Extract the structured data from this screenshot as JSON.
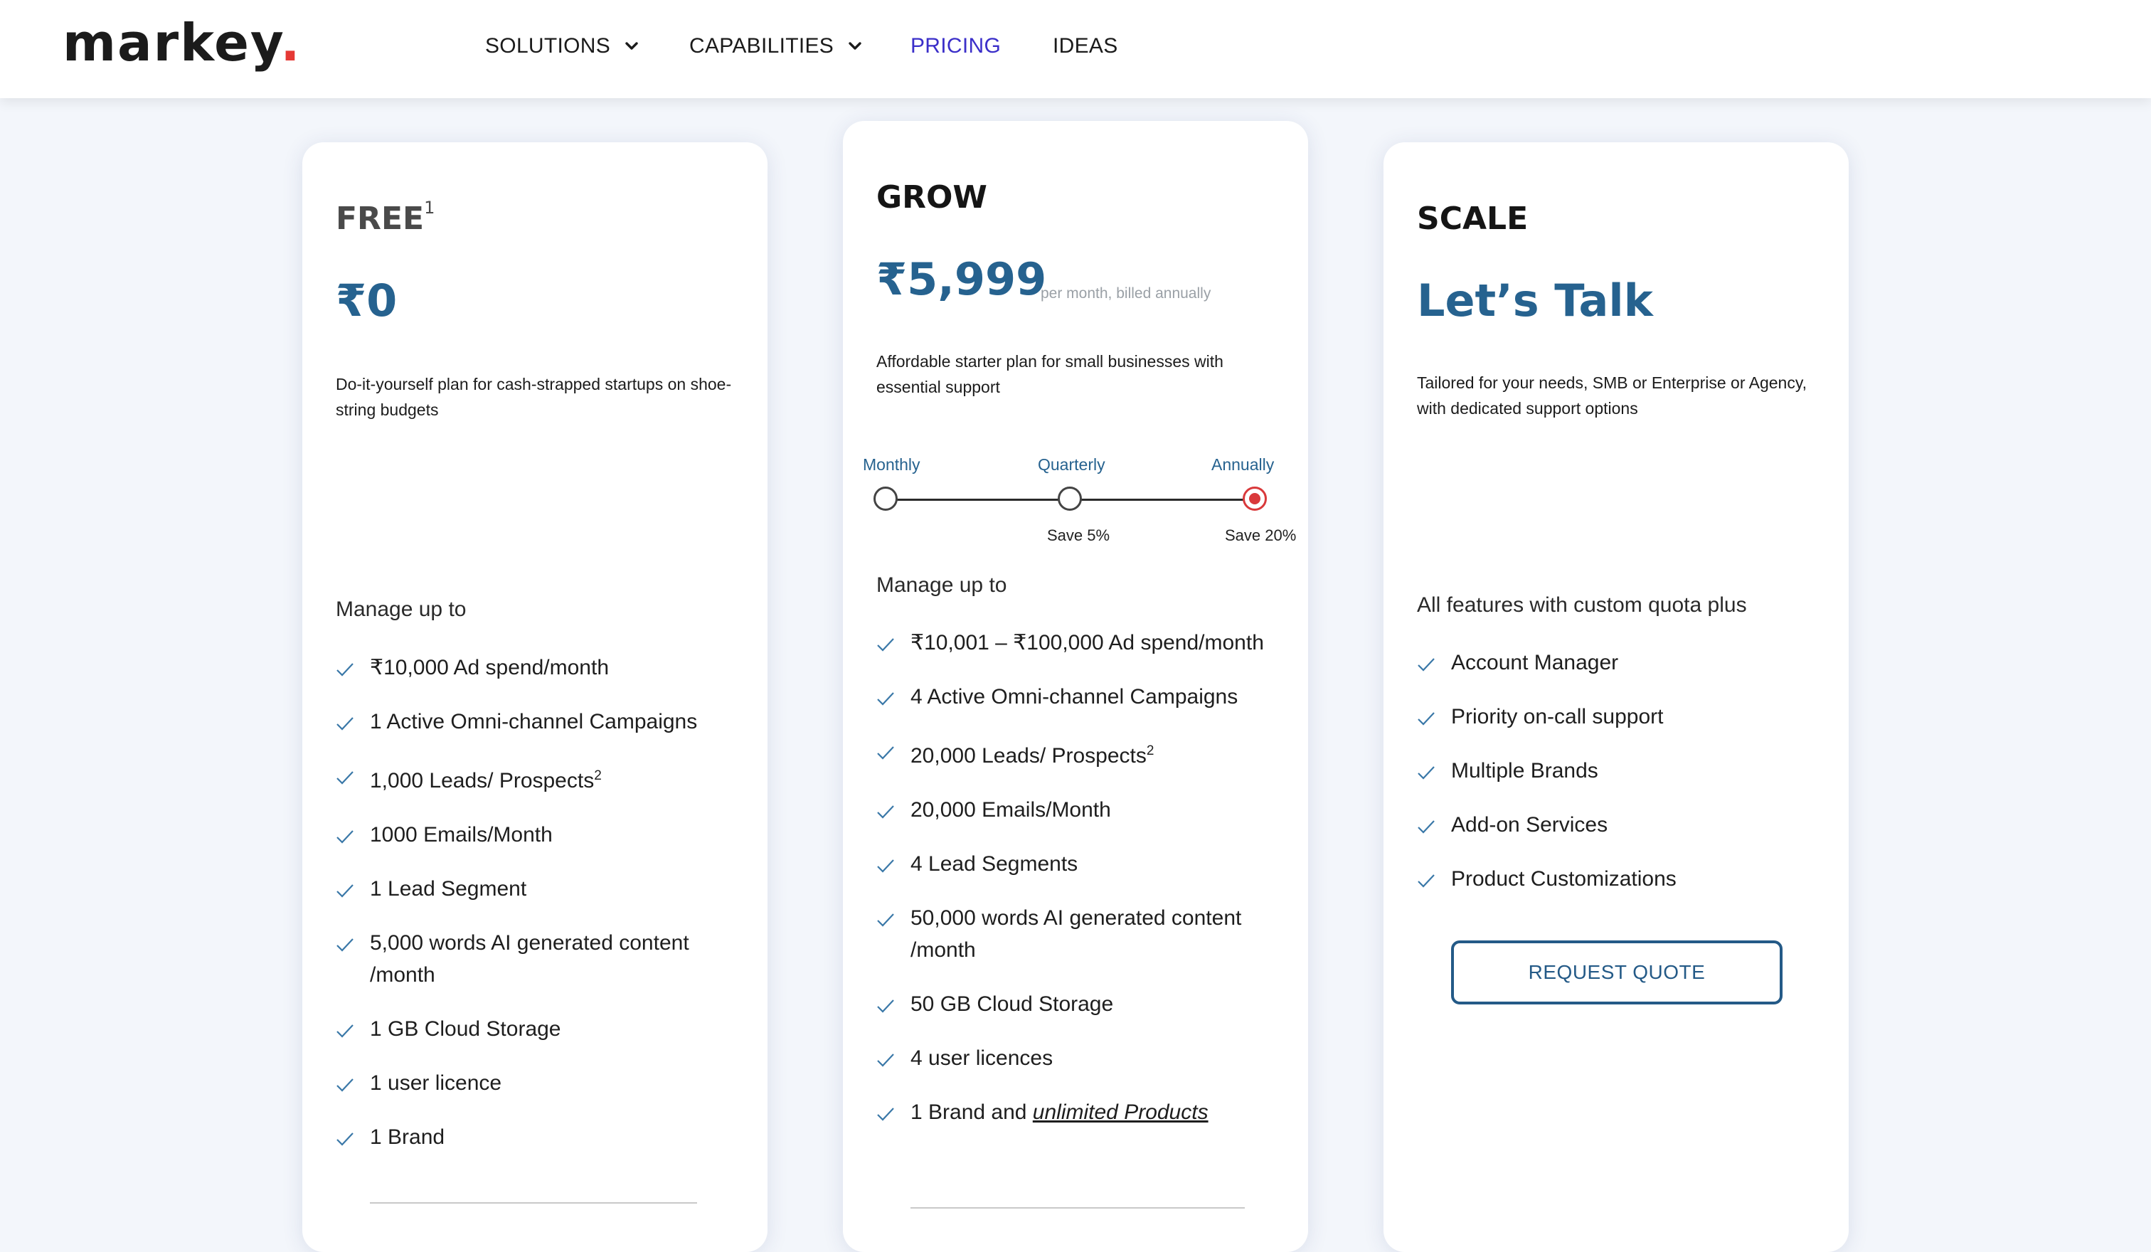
{
  "header": {
    "logo_text": "markey",
    "logo_dot": ".",
    "nav": [
      {
        "label": "SOLUTIONS",
        "has_dropdown": true,
        "active": false
      },
      {
        "label": "CAPABILITIES",
        "has_dropdown": true,
        "active": false
      },
      {
        "label": "PRICING",
        "has_dropdown": false,
        "active": true
      },
      {
        "label": "IDEAS",
        "has_dropdown": false,
        "active": false
      }
    ]
  },
  "colors": {
    "accent_blue": "#26628f",
    "nav_active": "#3b2fc9",
    "logo_dot": "#e53935",
    "selected_red": "#d9393b"
  },
  "plans": {
    "free": {
      "name": "FREE",
      "name_sup": "1",
      "price": "₹0",
      "description": "Do-it-yourself plan for cash-strapped startups on shoe-string budgets",
      "section_title": "Manage up to",
      "features": [
        {
          "text": "₹10,000 Ad spend/month"
        },
        {
          "text": "1 Active Omni-channel Campaigns"
        },
        {
          "text": "1,000 Leads/ Prospects",
          "sup": "2"
        },
        {
          "text": "1000 Emails/Month"
        },
        {
          "text": "1 Lead Segment"
        },
        {
          "text": "5,000 words AI generated content /month"
        },
        {
          "text": "1 GB Cloud Storage"
        },
        {
          "text": "1 user licence"
        },
        {
          "text": "1 Brand"
        }
      ]
    },
    "grow": {
      "name": "GROW",
      "price": "₹5,999",
      "price_note": "per month, billed annually",
      "description": "Affordable starter plan for small businesses with essential support",
      "billing": {
        "options": [
          "Monthly",
          "Quarterly",
          "Annually"
        ],
        "savings": [
          "",
          "Save 5%",
          "Save 20%"
        ],
        "selected": "Annually"
      },
      "section_title": "Manage up to",
      "features": [
        {
          "text": "₹10,001 – ₹100,000 Ad spend/month"
        },
        {
          "text": "4 Active Omni-channel Campaigns"
        },
        {
          "text": "20,000 Leads/ Prospects",
          "sup": "2"
        },
        {
          "text": "20,000 Emails/Month"
        },
        {
          "text": "4 Lead Segments"
        },
        {
          "text": "50,000 words AI generated content /month"
        },
        {
          "text": "50 GB Cloud Storage"
        },
        {
          "text": "4 user licences"
        },
        {
          "text": "1 Brand and ",
          "link": "unlimited Products"
        }
      ]
    },
    "scale": {
      "name": "SCALE",
      "price": "Let’s Talk",
      "description": "Tailored for your needs, SMB or Enterprise or Agency, with dedicated support options",
      "section_title": "All features with custom quota plus",
      "features": [
        {
          "text": "Account Manager"
        },
        {
          "text": "Priority on-call support"
        },
        {
          "text": "Multiple Brands"
        },
        {
          "text": "Add-on Services"
        },
        {
          "text": "Product Customizations"
        }
      ],
      "cta_label": "REQUEST QUOTE"
    }
  }
}
